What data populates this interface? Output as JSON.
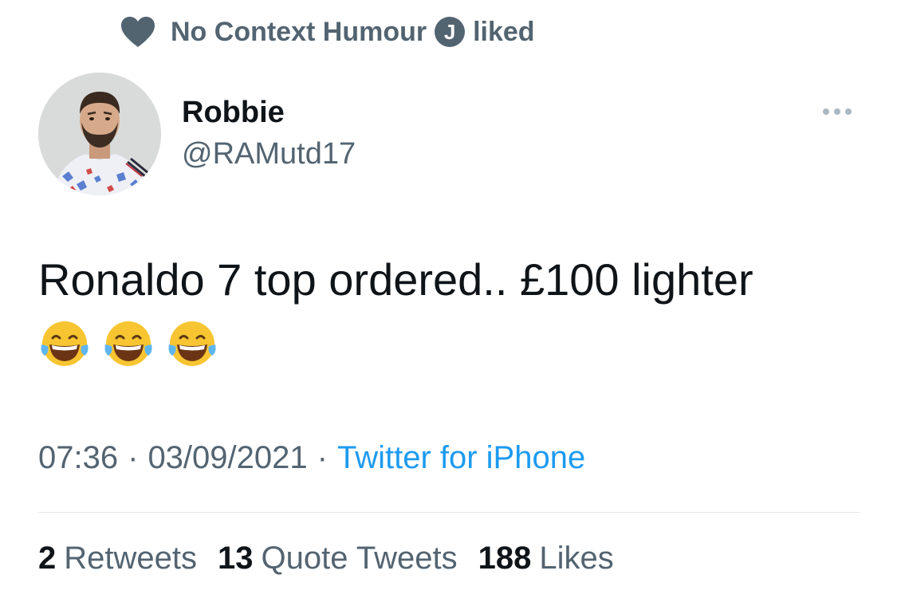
{
  "social_context": {
    "account": "No Context Humour",
    "badge": "J",
    "action": "liked",
    "icon": "heart-icon"
  },
  "tweet": {
    "author_name": "Robbie",
    "author_handle": "@RAMutd17",
    "text": "Ronaldo 7 top ordered.. £100 lighter",
    "emojis": [
      "face-with-tears-of-joy",
      "face-with-tears-of-joy",
      "face-with-tears-of-joy"
    ],
    "time": "07:36",
    "separator": "·",
    "date": "03/09/2021",
    "source": "Twitter for iPhone"
  },
  "stats": {
    "retweets_count": "2",
    "retweets_label": "Retweets",
    "quotes_count": "13",
    "quotes_label": "Quote Tweets",
    "likes_count": "188",
    "likes_label": "Likes"
  },
  "colors": {
    "text_primary": "#0f1419",
    "text_secondary": "#536471",
    "link": "#1d9bf0",
    "divider": "#e1e6ea"
  }
}
